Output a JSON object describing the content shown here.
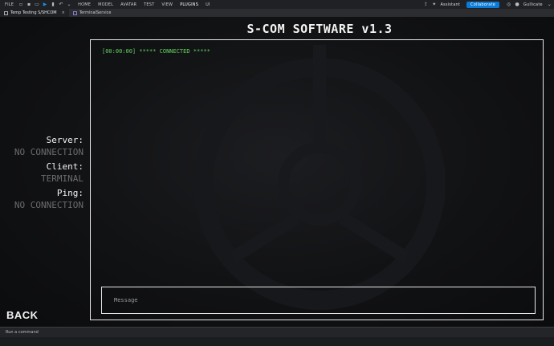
{
  "menubar": {
    "file": "FILE",
    "tools": [
      "document-icon",
      "save-icon",
      "folder-icon",
      "play-icon",
      "step-icon",
      "undo-icon",
      "redo-icon"
    ],
    "items": [
      {
        "label": "HOME"
      },
      {
        "label": "MODEL"
      },
      {
        "label": "AVATAR"
      },
      {
        "label": "TEST"
      },
      {
        "label": "VIEW"
      },
      {
        "label": "PLUGINS",
        "active": true
      },
      {
        "label": "UI"
      }
    ],
    "assistant": "Assistant",
    "collaborate": "Collaborate",
    "user": "Gullicate",
    "accent": "#0b7ad6"
  },
  "tabs": [
    {
      "label": "Temp Testing S/SHCOM",
      "active": true
    },
    {
      "label": "TerminalService",
      "active": false
    }
  ],
  "screen": {
    "title": "S-COM SOFTWARE v1.3",
    "server_label": "Server:",
    "server_value": "NO CONNECTION",
    "client_label": "Client:",
    "client_value": "TERMINAL",
    "ping_label": "Ping:",
    "ping_value": "NO CONNECTION",
    "back": "BACK",
    "log_lines": [
      "[00:00:00] ***** CONNECTED *****"
    ],
    "log_color": "#63d460",
    "message_placeholder": "Message"
  },
  "command": {
    "placeholder": "Run a command"
  }
}
